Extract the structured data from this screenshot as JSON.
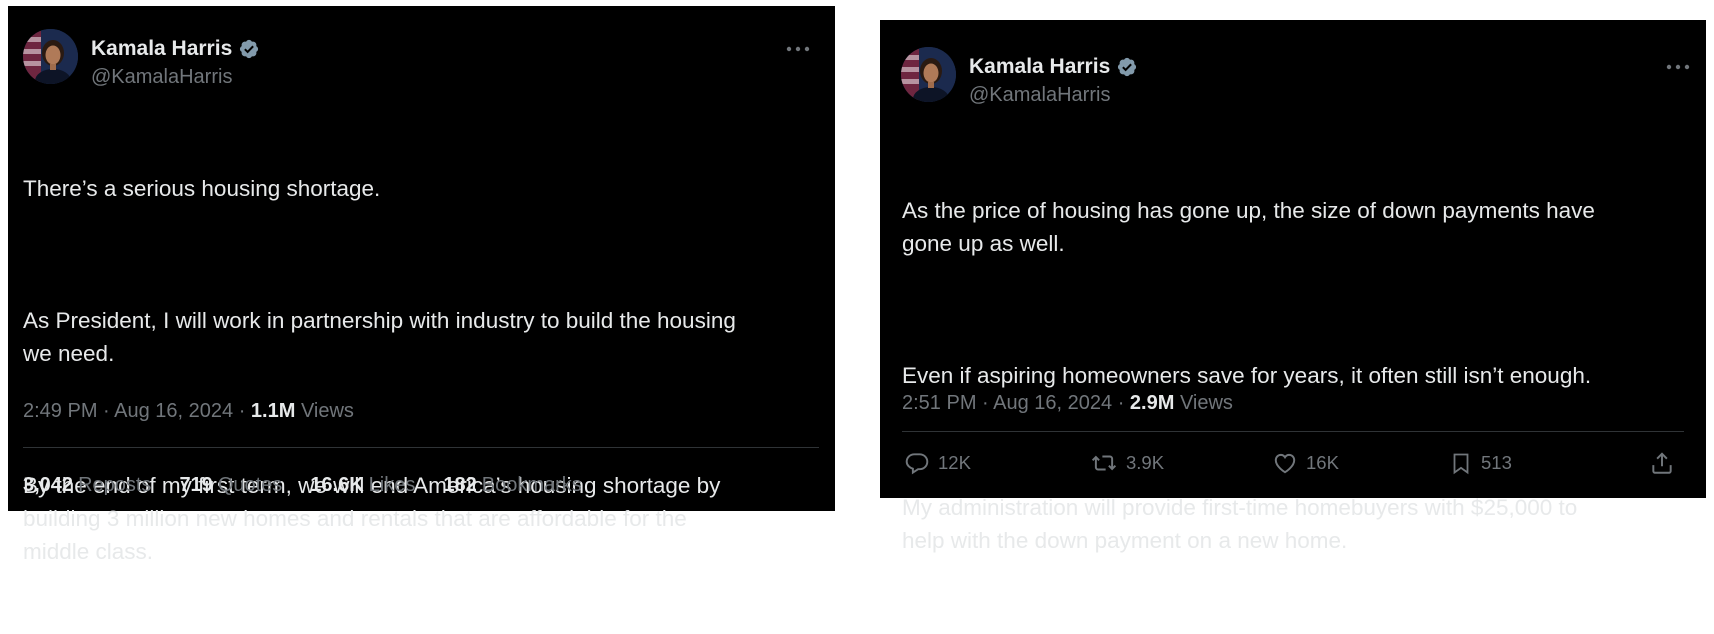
{
  "tweets": [
    {
      "author": {
        "name": "Kamala Harris",
        "handle": "@KamalaHarris"
      },
      "paragraphs": [
        "There’s a serious housing shortage.",
        "As President, I will work in partnership with industry to build the housing\nwe need.",
        "By the end of my first term, we will end America’s housing shortage by\nbuilding 3 million new homes and rentals that are affordable for the\nmiddle class."
      ],
      "timestamp": "2:49 PM · Aug 16, 2024 · ",
      "views_count": "1.1M",
      "views_label": " Views",
      "stats": {
        "reposts": {
          "count": "3,042",
          "label": "Reposts"
        },
        "quotes": {
          "count": "719",
          "label": "Quotes"
        },
        "likes": {
          "count": "16.6K",
          "label": "Likes"
        },
        "bookmarks": {
          "count": "182",
          "label": "Bookmarks"
        }
      }
    },
    {
      "author": {
        "name": "Kamala Harris",
        "handle": "@KamalaHarris"
      },
      "paragraphs": [
        "As the price of housing has gone up, the size of down payments have\ngone up as well.",
        "Even if aspiring homeowners save for years, it often still isn’t enough.",
        "My administration will provide first-time homebuyers with $25,000 to\nhelp with the down payment on a new home."
      ],
      "timestamp": "2:51 PM · Aug 16, 2024 · ",
      "views_count": "2.9M",
      "views_label": " Views",
      "actions": {
        "replies": "12K",
        "reposts": "3.9K",
        "likes": "16K",
        "bookmarks": "513"
      }
    }
  ],
  "colors": {
    "background": "#000000",
    "text": "#e7e9ea",
    "muted": "#71767b",
    "divider": "#2f3336",
    "verified": "#829aab"
  },
  "icons": [
    "verified-badge-icon",
    "more-options-icon",
    "reply-icon",
    "repost-icon",
    "like-icon",
    "bookmark-icon",
    "share-icon"
  ]
}
